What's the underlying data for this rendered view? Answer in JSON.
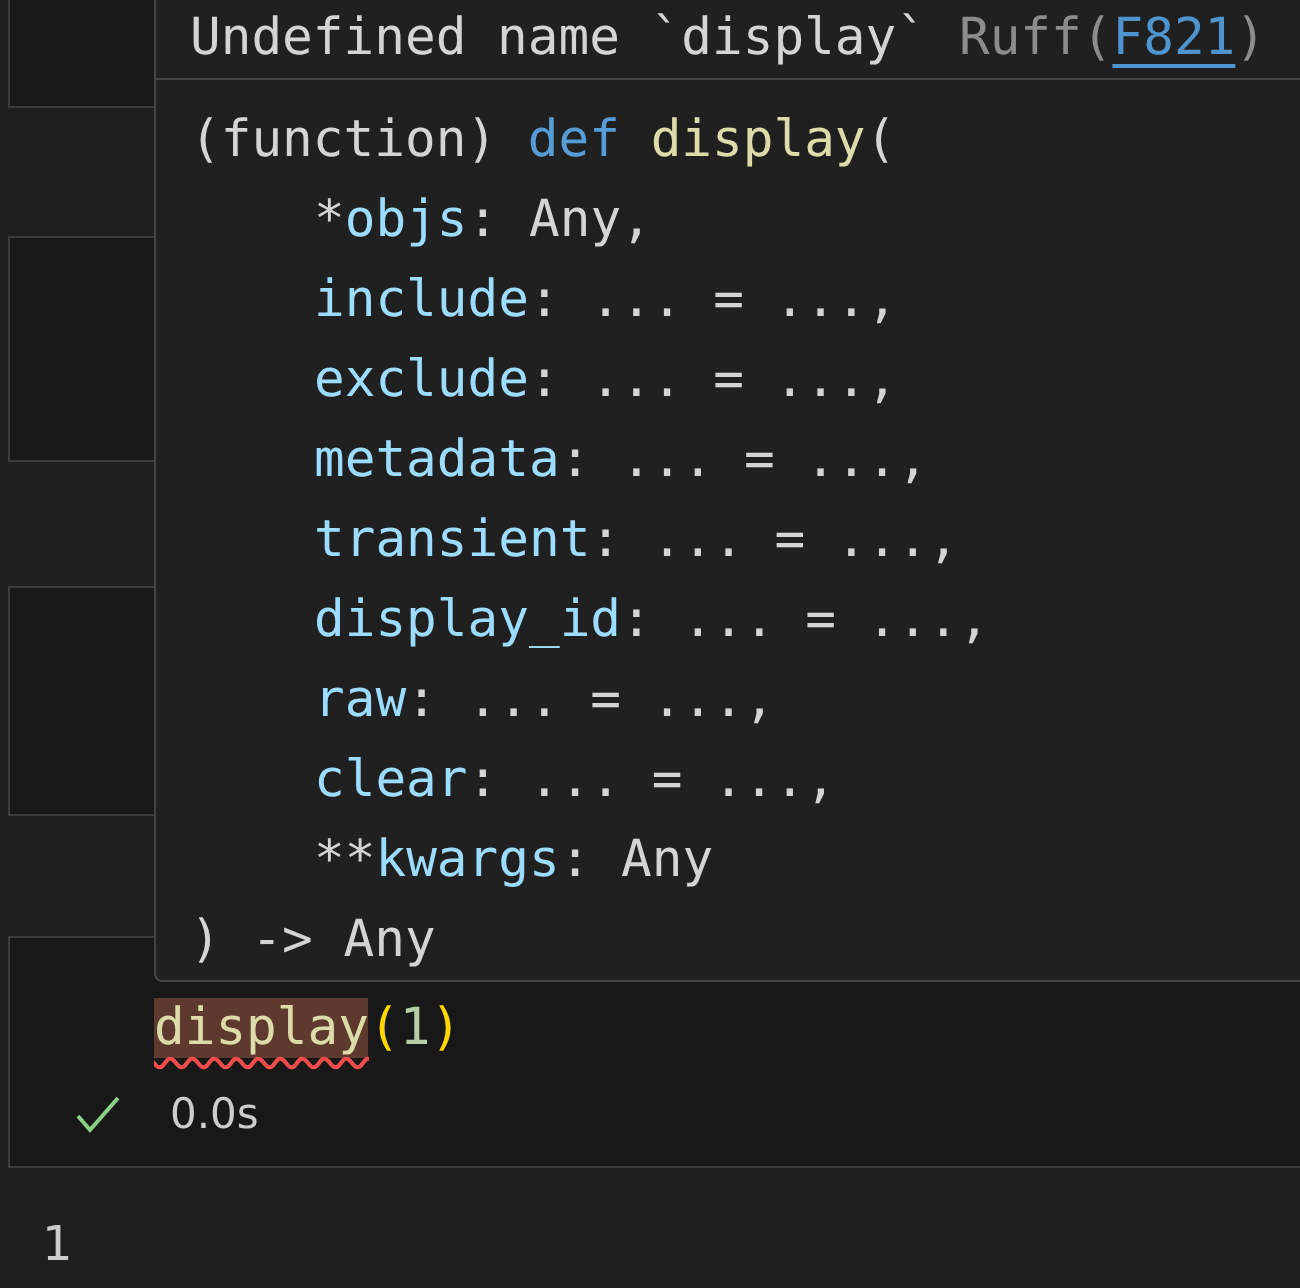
{
  "hover": {
    "message": "Undefined name `display`",
    "source": "Ruff(",
    "code": "F821",
    "source_end": ")",
    "signature": {
      "prefix": "(function)",
      "keyword": "def",
      "name": "display",
      "open": "("
    },
    "params": [
      {
        "marker": "*",
        "name": "objs",
        "rest": ": Any,"
      },
      {
        "name": "include",
        "rest": ": ... = ...,"
      },
      {
        "name": "exclude",
        "rest": ": ... = ...,"
      },
      {
        "name": "metadata",
        "rest": ": ... = ...,"
      },
      {
        "name": "transient",
        "rest": ": ... = ...,"
      },
      {
        "name": "display_id",
        "rest": ": ... = ...,"
      },
      {
        "name": "raw",
        "rest": ": ... = ...,"
      },
      {
        "name": "clear",
        "rest": ": ... = ...,"
      },
      {
        "marker": "**",
        "name": "kwargs",
        "rest": ": Any"
      }
    ],
    "close": ") -> Any"
  },
  "cell": {
    "code": {
      "func": "display",
      "open": "(",
      "arg": "1",
      "close": ")",
      "error": true
    },
    "status": {
      "success": true,
      "time": "0.0s"
    },
    "output": "1"
  }
}
